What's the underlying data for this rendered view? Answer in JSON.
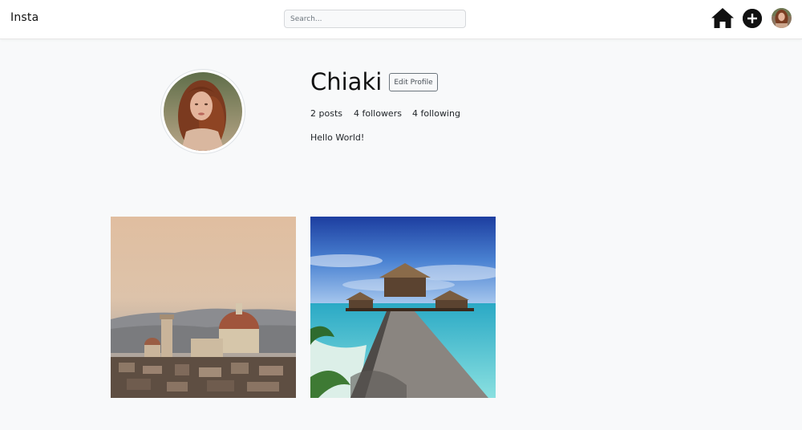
{
  "navbar": {
    "brand": "Insta",
    "search_placeholder": "Search..."
  },
  "profile": {
    "username": "Chiaki",
    "edit_button": "Edit Profile",
    "posts": "2 posts",
    "followers": "4 followers",
    "following": "4 following",
    "bio": "Hello World!"
  },
  "icons": {
    "home": "home-icon",
    "add": "plus-circle-icon"
  },
  "colors": {
    "background": "#f8f9fa",
    "navbar": "#ffffff",
    "icon": "#111111"
  }
}
